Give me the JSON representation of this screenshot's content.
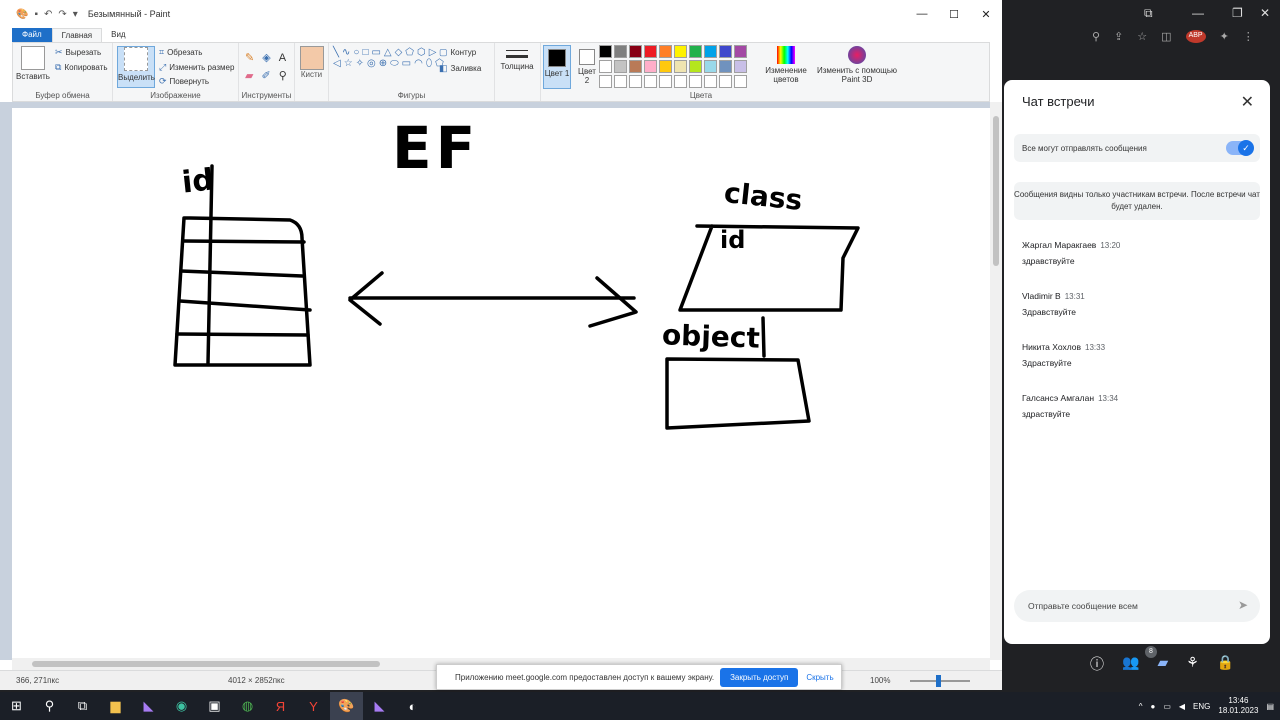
{
  "window": {
    "title": "Безымянный - Paint",
    "controls": [
      "—",
      "☐",
      "✕"
    ]
  },
  "tabs": [
    {
      "label": "Файл"
    },
    {
      "label": "Главная"
    },
    {
      "label": "Вид"
    }
  ],
  "ribbon": {
    "clipboard": {
      "paste": "Вставить",
      "cut": "Вырезать",
      "copy": "Копировать",
      "label": "Буфер обмена"
    },
    "image": {
      "select": "Выделить",
      "crop": "Обрезать",
      "resize": "Изменить размер",
      "rotate": "Повернуть",
      "label": "Изображение"
    },
    "tools": {
      "label": "Инструменты"
    },
    "brushes": {
      "label": "Кисти"
    },
    "shapes": {
      "outline": "Контур",
      "fill": "Заливка",
      "label": "Фигуры"
    },
    "size": {
      "label": "Толщина"
    },
    "colors": {
      "color1": "Цвет 1",
      "color2": "Цвет 2",
      "edit": "Изменение цветов",
      "paint3d": "Изменить с помощью Paint 3D",
      "label": "Цвета"
    },
    "palette": [
      "#000000",
      "#7f7f7f",
      "#880015",
      "#ed1c24",
      "#ff7f27",
      "#fff200",
      "#22b14c",
      "#00a2e8",
      "#3f48cc",
      "#a349a4",
      "#ffffff",
      "#c3c3c3",
      "#b97a57",
      "#ffaec9",
      "#ffc90e",
      "#efe4b0",
      "#b5e61d",
      "#99d9ea",
      "#7092be",
      "#c8bfe7",
      "#ffffff",
      "#ffffff",
      "#ffffff",
      "#ffffff",
      "#ffffff",
      "#ffffff",
      "#ffffff",
      "#ffffff",
      "#ffffff",
      "#ffffff"
    ]
  },
  "drawing": {
    "title": "EF",
    "left_label": "id",
    "right_top_label": "class",
    "right_inner_label": "id",
    "right_bottom_label": "object"
  },
  "status": {
    "cursor": "366, 271пкс",
    "canvas_size": "4012 × 2852пкс",
    "zoom": "100%"
  },
  "share_bar": {
    "message": "Приложению meet.google.com предоставлен доступ к вашему экрану.",
    "stop": "Закрыть доступ",
    "hide": "Скрыть"
  },
  "chat": {
    "title": "Чат встречи",
    "toggle_label": "Все могут отправлять сообщения",
    "notice": "Сообщения видны только участникам встречи. После встречи чат будет удален.",
    "messages": [
      {
        "author": "Жаргал Маракгаев",
        "time": "13:20",
        "text": "здравствуйте"
      },
      {
        "author": "Vladimir B",
        "time": "13:31",
        "text": "Здравствуйте"
      },
      {
        "author": "Никита Хохлов",
        "time": "13:33",
        "text": "Здраствуйте"
      },
      {
        "author": "Галсансэ Амгалан",
        "time": "13:34",
        "text": "здраствуйте"
      }
    ],
    "input_placeholder": "Отправьте сообщение всем",
    "participants_count": "8"
  },
  "taskbar": {
    "lang": "ENG",
    "time": "13:46",
    "date": "18.01.2023"
  }
}
